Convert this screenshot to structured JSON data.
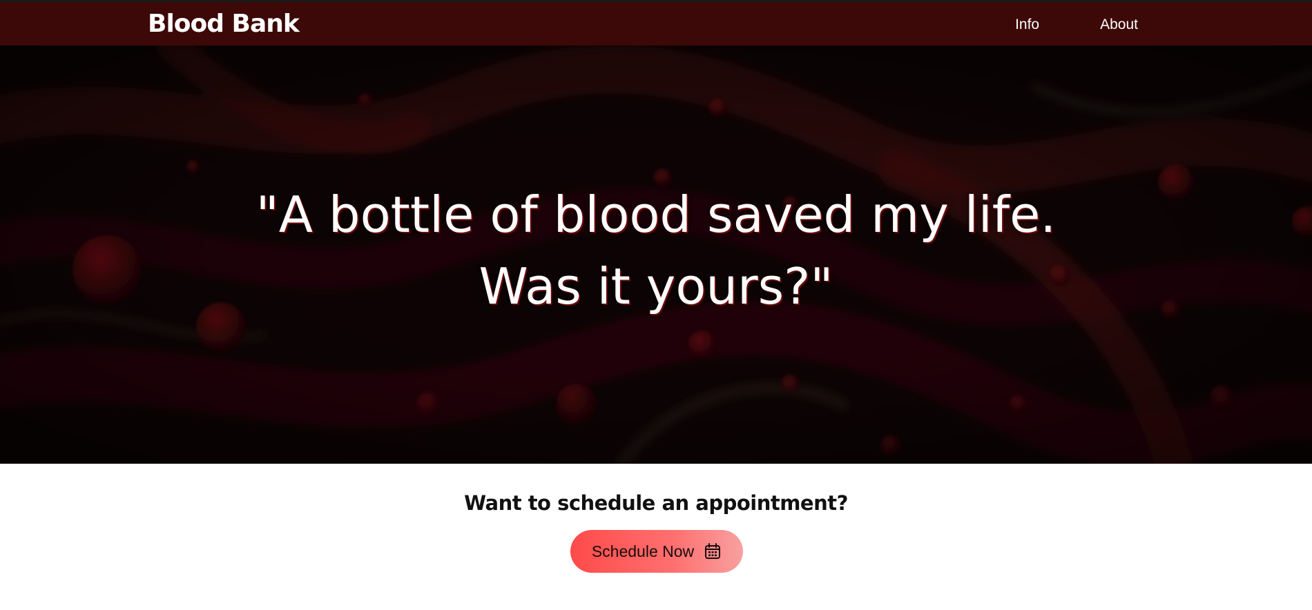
{
  "navbar": {
    "brand": "Blood Bank",
    "links": [
      {
        "label": "Info"
      },
      {
        "label": "About"
      }
    ]
  },
  "hero": {
    "quote_line1": "\"A bottle of blood saved my life.",
    "quote_line2": "Was it yours?\""
  },
  "cta": {
    "title": "Want to schedule an appointment?",
    "button_label": "Schedule Now",
    "button_icon": "calendar-icon"
  },
  "colors": {
    "navbar_bg": "#3d0808",
    "hero_bg": "#150607",
    "button_gradient_start": "#ff4a4a",
    "button_gradient_end": "#f8a0a0"
  }
}
